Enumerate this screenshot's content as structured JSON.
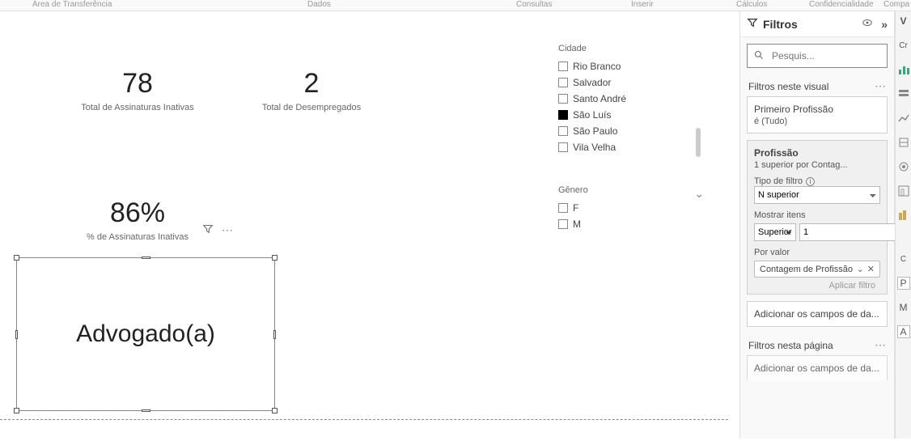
{
  "ribbon": {
    "areaTransferencia": "Área de Transferência",
    "dados": "Dados",
    "consultas": "Consultas",
    "inserir": "Inserir",
    "calculos": "Cálculos",
    "confidencialidade": "Confidencialidade",
    "compartilhar": "Compa"
  },
  "cards": {
    "inativas": {
      "value": "78",
      "label": "Total de Assinaturas Inativas"
    },
    "desempregados": {
      "value": "2",
      "label": "Total de Desempregados"
    },
    "pct": {
      "value": "86%",
      "label": "% de Assinaturas Inativas"
    }
  },
  "visualSelected": {
    "profession": "Advogado(a)"
  },
  "slicers": {
    "cidade": {
      "title": "Cidade",
      "items": [
        {
          "label": "Rio Branco",
          "checked": false
        },
        {
          "label": "Salvador",
          "checked": false
        },
        {
          "label": "Santo André",
          "checked": false
        },
        {
          "label": "São Luís",
          "checked": true
        },
        {
          "label": "São Paulo",
          "checked": false
        },
        {
          "label": "Vila Velha",
          "checked": false
        }
      ]
    },
    "genero": {
      "title": "Gênero",
      "items": [
        {
          "label": "F",
          "checked": false
        },
        {
          "label": "M",
          "checked": false
        }
      ]
    }
  },
  "filtersPane": {
    "title": "Filtros",
    "searchPlaceholder": "Pesquis...",
    "section1": "Filtros neste visual",
    "card1": {
      "line1": "Primeiro Profissão",
      "line2": "é (Tudo)"
    },
    "profGroup": {
      "title": "Profissão",
      "subtitle": "1 superior por Contag...",
      "tipoLabel": "Tipo de filtro",
      "tipoValue": "N superior",
      "mostrarLabel": "Mostrar itens",
      "mostrarSelect": "Superior",
      "mostrarCount": "1",
      "porValorLabel": "Por valor",
      "chip": "Contagem de Profissão",
      "apply": "Aplicar filtro"
    },
    "addField": "Adicionar os campos de da...",
    "section2": "Filtros nesta página",
    "addField2": "Adicionar os campos de da..."
  },
  "sideStrip": {
    "v": "V",
    "cr": "Cr",
    "p": "P",
    "m": "M",
    "a": "A"
  }
}
